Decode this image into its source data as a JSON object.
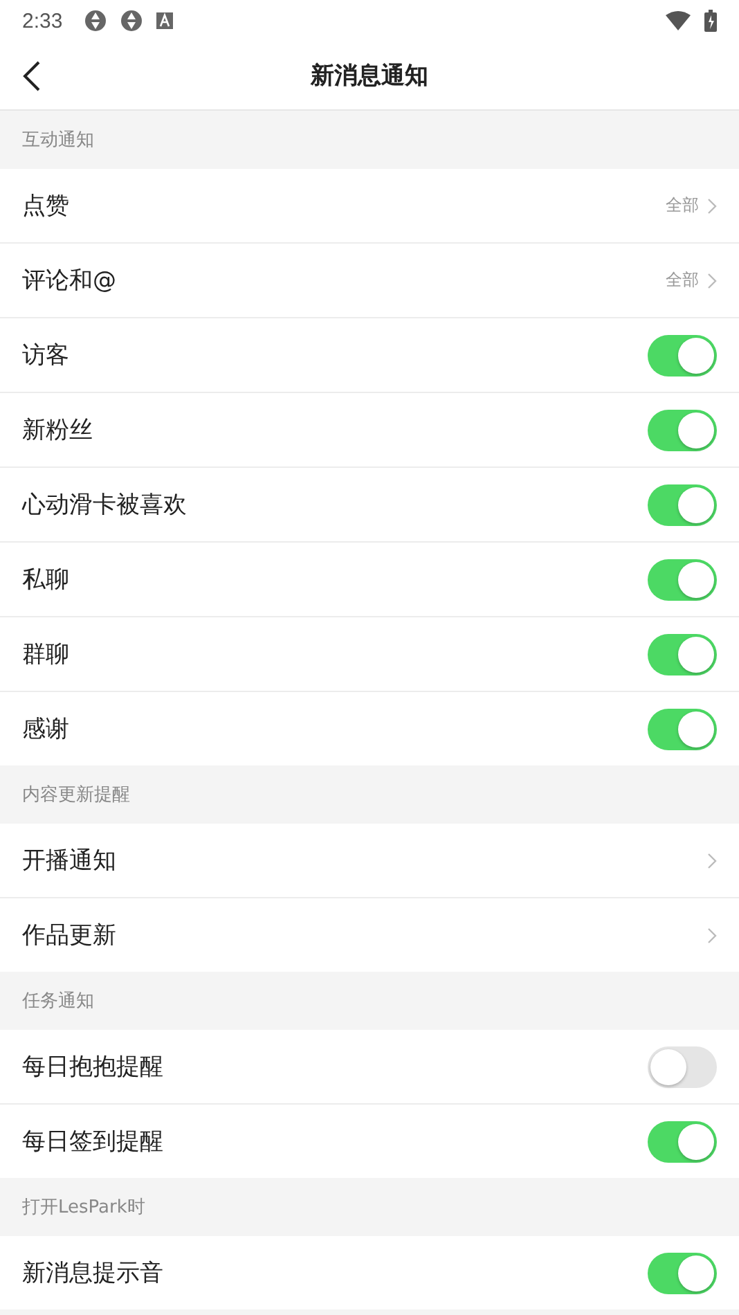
{
  "status_bar": {
    "time": "2:33"
  },
  "header": {
    "title": "新消息通知"
  },
  "sections": [
    {
      "title": "互动通知",
      "items": [
        {
          "kind": "link",
          "label": "点赞",
          "value": "全部"
        },
        {
          "kind": "link",
          "label": "评论和@",
          "value": "全部"
        },
        {
          "kind": "toggle",
          "label": "访客",
          "on": true
        },
        {
          "kind": "toggle",
          "label": "新粉丝",
          "on": true
        },
        {
          "kind": "toggle",
          "label": "心动滑卡被喜欢",
          "on": true
        },
        {
          "kind": "toggle",
          "label": "私聊",
          "on": true
        },
        {
          "kind": "toggle",
          "label": "群聊",
          "on": true
        },
        {
          "kind": "toggle",
          "label": "感谢",
          "on": true
        }
      ]
    },
    {
      "title": "内容更新提醒",
      "items": [
        {
          "kind": "link",
          "label": "开播通知"
        },
        {
          "kind": "link",
          "label": "作品更新"
        }
      ]
    },
    {
      "title": "任务通知",
      "items": [
        {
          "kind": "toggle",
          "label": "每日抱抱提醒",
          "on": false
        },
        {
          "kind": "toggle",
          "label": "每日签到提醒",
          "on": true
        }
      ]
    },
    {
      "title": "打开LesPark时",
      "items": [
        {
          "kind": "toggle",
          "label": "新消息提示音",
          "on": true
        }
      ]
    }
  ]
}
